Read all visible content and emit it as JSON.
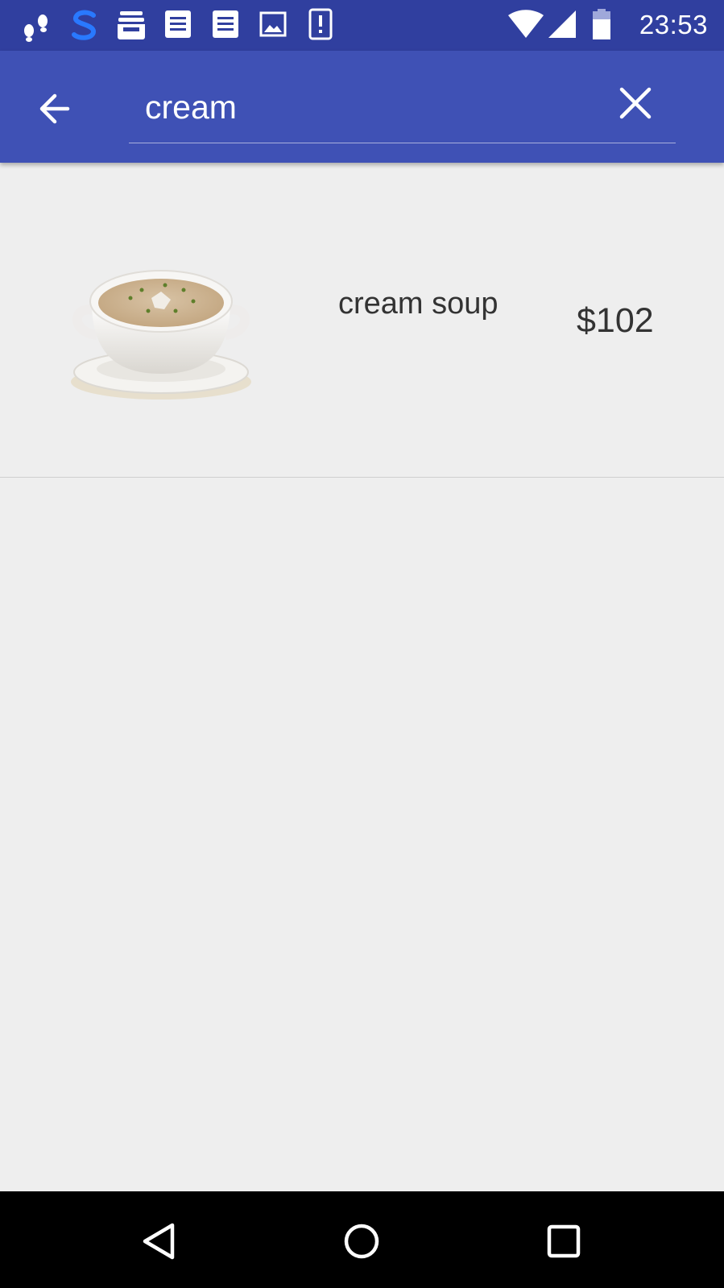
{
  "status_bar": {
    "time": "23:53",
    "left_icons": [
      "footsteps-icon",
      "s-app-icon",
      "inbox-tray-icon",
      "document-icon",
      "document-icon",
      "image-icon",
      "alert-icon"
    ],
    "right_icons": [
      "wifi-icon",
      "signal-icon",
      "battery-icon"
    ]
  },
  "app_bar": {
    "color": "#3f51b5",
    "search_value": "cream",
    "back_icon": "arrow-back-icon",
    "clear_icon": "close-icon"
  },
  "results": [
    {
      "name": "cream soup",
      "price": "$102",
      "image": "cream-soup-bowl"
    }
  ],
  "nav_bar": {
    "icons": [
      "back-triangle-icon",
      "home-circle-icon",
      "recents-square-icon"
    ]
  }
}
